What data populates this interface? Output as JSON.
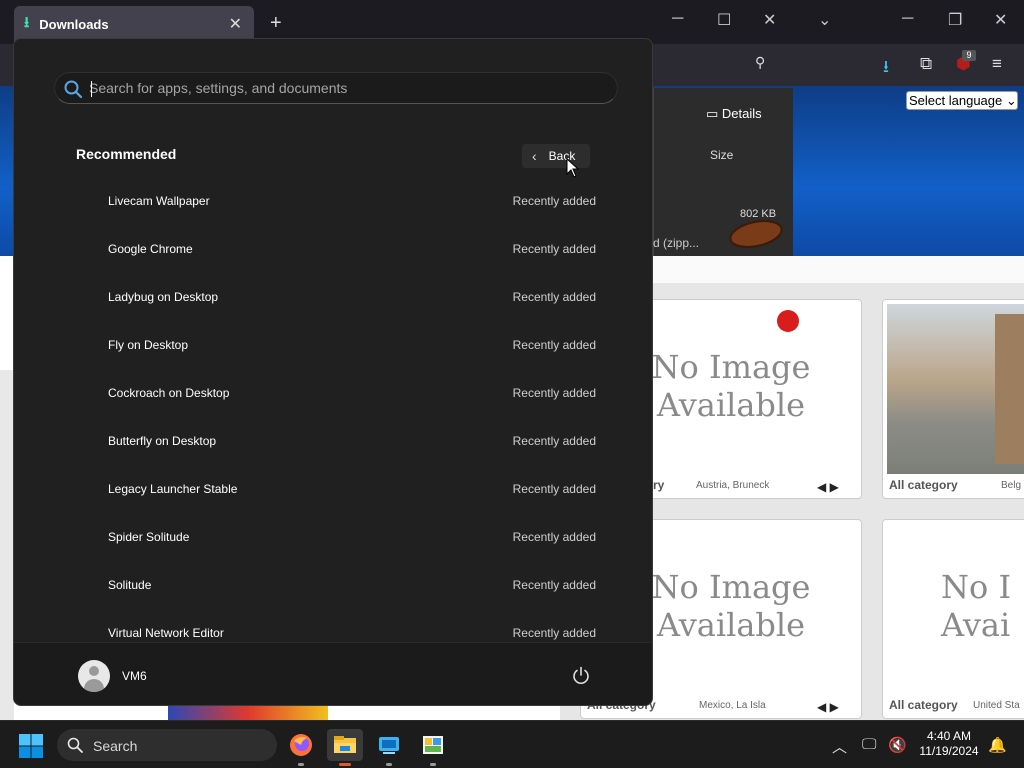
{
  "browser": {
    "tab_title": "Downloads",
    "language_select": "Select language",
    "notification_count": "9",
    "downloads_panel": {
      "details_label": "Details",
      "size_header": "Size",
      "file_size": "802 KB",
      "file_name_fragment": "d (zipp..."
    },
    "cards": [
      {
        "line1": "No Image",
        "line2": "Available",
        "category": "ry",
        "location": "Austria, Bruneck"
      },
      {
        "category": "All category",
        "location": "Belg"
      },
      {
        "line1": "No Image",
        "line2": "Available",
        "category": "All category",
        "location": "Mexico, La Isla"
      },
      {
        "line1": "No I",
        "line2": "Avai",
        "category": "All category",
        "location": "United Sta"
      }
    ]
  },
  "start_menu": {
    "search_placeholder": "Search for apps, settings, and documents",
    "recommended_title": "Recommended",
    "back_label": "Back",
    "items": [
      {
        "name": "Livecam Wallpaper",
        "status": "Recently added"
      },
      {
        "name": "Google Chrome",
        "status": "Recently added"
      },
      {
        "name": "Ladybug on Desktop",
        "status": "Recently added"
      },
      {
        "name": "Fly on Desktop",
        "status": "Recently added"
      },
      {
        "name": "Cockroach on Desktop",
        "status": "Recently added"
      },
      {
        "name": "Butterfly on Desktop",
        "status": "Recently added"
      },
      {
        "name": "Legacy Launcher Stable",
        "status": "Recently added"
      },
      {
        "name": "Spider Solitude",
        "status": "Recently added"
      },
      {
        "name": "Solitude",
        "status": "Recently added"
      },
      {
        "name": "Virtual Network Editor",
        "status": "Recently added"
      }
    ],
    "user_name": "VM6"
  },
  "taskbar": {
    "search_label": "Search",
    "time": "4:40 AM",
    "date": "11/19/2024",
    "apps": [
      "firefox-icon",
      "file-explorer-icon",
      "app-store-icon",
      "paint-icon"
    ]
  },
  "colors": {
    "accent_teal": "#3fe1b0",
    "menu_bg": "#202020",
    "taskbar_bg": "#1c1c1c",
    "windows_blue": "#0078d4"
  }
}
